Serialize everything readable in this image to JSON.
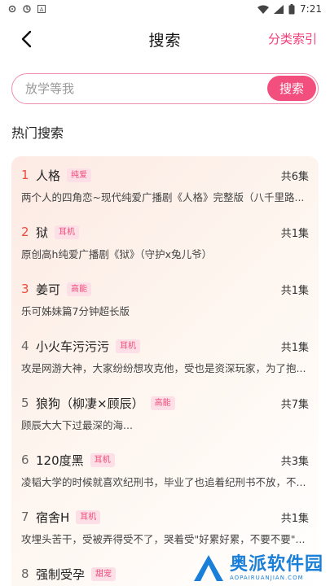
{
  "status_bar": {
    "time": "7:21",
    "left_icons": [
      "settings-icon",
      "circle-icon",
      "a-icon"
    ],
    "right_icons": [
      "wifi-icon",
      "signal-icon",
      "battery-icon"
    ]
  },
  "header": {
    "title": "搜索",
    "right_link": "分类索引"
  },
  "search": {
    "placeholder": "放学等我",
    "value": "",
    "button_label": "搜索"
  },
  "hot": {
    "title": "热门搜索",
    "items": [
      {
        "rank": "1",
        "name": "人格",
        "tag": "纯爱",
        "count": "共6集",
        "desc": "两个人的四角恋~现代纯爱广播剧《人格》完整版（八千里路..."
      },
      {
        "rank": "2",
        "name": "狱",
        "tag": "耳机",
        "count": "共1集",
        "desc": "原创高h纯爱广播剧《狱》（守护x兔儿爷）"
      },
      {
        "rank": "3",
        "name": "姜可",
        "tag": "高能",
        "count": "共1集",
        "desc": "乐可姊妹篇7分钟超长版"
      },
      {
        "rank": "4",
        "name": "小火车污污污",
        "tag": "耳机",
        "count": "共1集",
        "desc": "攻是网游大神，大家纷纷想攻克他，受也是资深玩家，为了抱..."
      },
      {
        "rank": "5",
        "name": "狼狗（柳凄×顾辰）",
        "tag": "高能",
        "count": "共7集",
        "desc": "顾辰大大下过最深的海..."
      },
      {
        "rank": "6",
        "name": "120度黑",
        "tag": "耳机",
        "count": "共3集",
        "desc": "凌韬大学的时候就喜欢纪刑书，毕业了也追着纪刑书不放，不..."
      },
      {
        "rank": "7",
        "name": "宿舍H",
        "tag": "耳机",
        "count": "共1集",
        "desc": "攻埋头苦干，受被弄得受不了，哭着受\"好累好累，不要不要\"..."
      },
      {
        "rank": "8",
        "name": "强制受孕",
        "tag": "甜宠",
        "count": "",
        "desc": ""
      }
    ]
  },
  "watermark": {
    "text": "奥派软件园",
    "sub": "AOPAIRUANJIAN.COM"
  },
  "colors": {
    "accent": "#f24f7f",
    "hot_rank": "#ee4a3c",
    "tag_bg": "#fde0e7"
  }
}
